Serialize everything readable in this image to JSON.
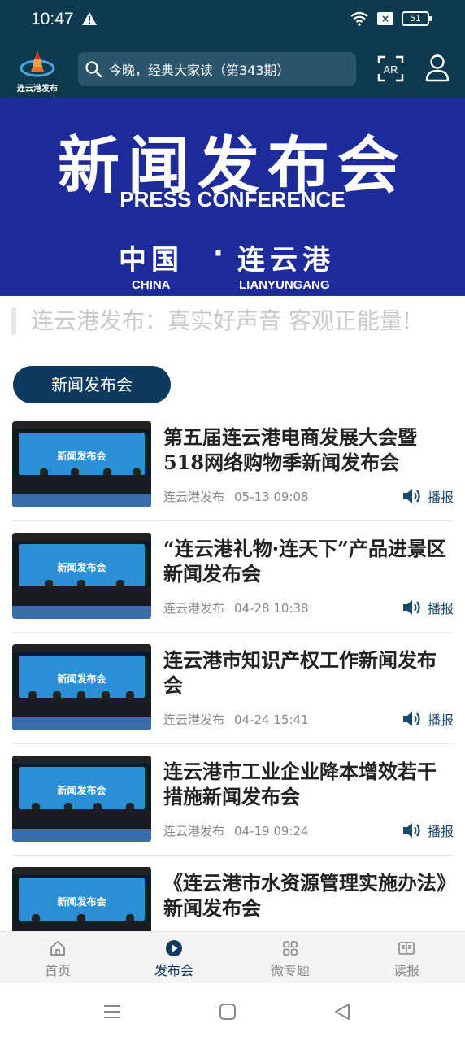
{
  "status": {
    "time": "10:47",
    "battery": "51"
  },
  "header": {
    "logo_text": "连云港发布",
    "search_placeholder": "今晚，经典大家读（第343期）",
    "ar_label": "AR"
  },
  "banner": {
    "title": "新闻发布会",
    "subtitle": "PRESS CONFERENCE",
    "left_cn": "中国",
    "dot": "·",
    "right_cn": "连云港",
    "left_en": "CHINA",
    "right_en": "LIANYUNGANG"
  },
  "slogan": "连云港发布：真实好声音  客观正能量!",
  "section_tag": "新闻发布会",
  "news": [
    {
      "title": "第五届连云港电商发展大会暨518网络购物季新闻发布会",
      "source": "连云港发布",
      "date": "05-13 09:08",
      "play": "播报",
      "thumb_text": "新闻发布会"
    },
    {
      "title": "“连云港礼物·连天下”产品进景区新闻发布会",
      "source": "连云港发布",
      "date": "04-28 10:38",
      "play": "播报",
      "thumb_text": "新闻发布会"
    },
    {
      "title": "连云港市知识产权工作新闻发布会",
      "source": "连云港发布",
      "date": "04-24 15:41",
      "play": "播报",
      "thumb_text": "新闻发布会"
    },
    {
      "title": "连云港市工业企业降本增效若干措施新闻发布会",
      "source": "连云港发布",
      "date": "04-19 09:24",
      "play": "播报",
      "thumb_text": "新闻发布会"
    },
    {
      "title": "《连云港市水资源管理实施办法》新闻发布会",
      "source": "",
      "date": "",
      "play": "",
      "thumb_text": "新闻发布会"
    }
  ],
  "bottom_nav": [
    {
      "label": "首页",
      "icon": "home-icon"
    },
    {
      "label": "发布会",
      "icon": "play-circle-icon",
      "active": true
    },
    {
      "label": "微专题",
      "icon": "grid-icon"
    },
    {
      "label": "读报",
      "icon": "newspaper-icon"
    }
  ],
  "colors": {
    "header": "#0d3a4e",
    "banner": "#1d2c9a",
    "accent": "#0d3a5e"
  }
}
